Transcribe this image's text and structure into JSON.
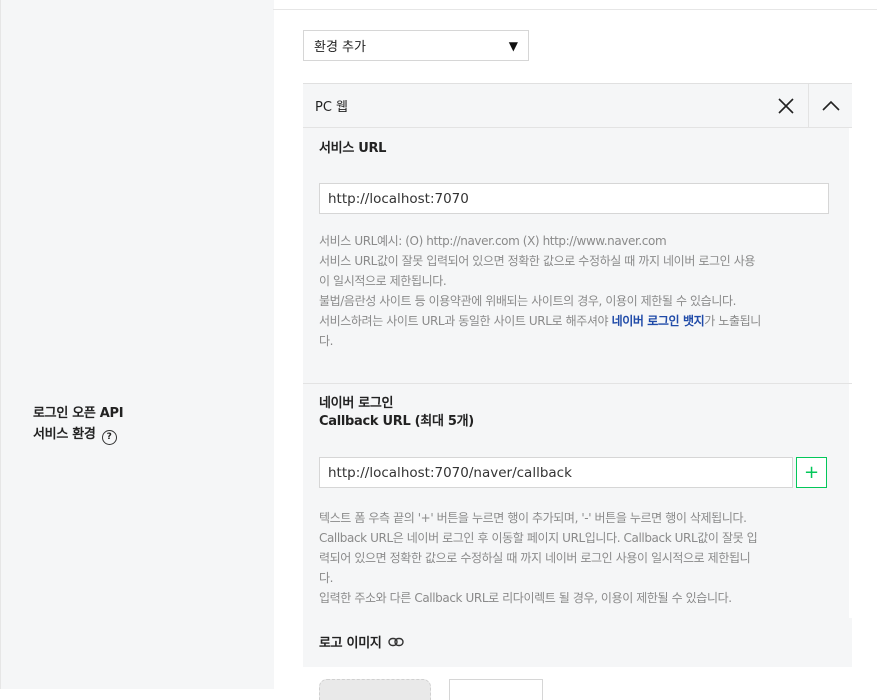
{
  "field": {
    "label_line1": "로그인 오픈 API",
    "label_line2": "서비스 환경",
    "help": "?"
  },
  "env_select": {
    "value": "환경 추가",
    "caret": "▼"
  },
  "panel": {
    "title": "PC 웹",
    "service_url": {
      "title": "서비스 URL",
      "value": "http://localhost:7070",
      "help": [
        "서비스 URL예시: (O) http://naver.com (X) http://www.naver.com",
        "서비스 URL값이 잘못 입력되어 있으면 정확한 값으로 수정하실 때 까지 네이버 로그인 사용",
        "이 일시적으로 제한됩니다.",
        "불법/음란성 사이트 등 이용약관에 위배되는 사이트의 경우, 이용이 제한될 수 있습니다."
      ],
      "help_last_prefix": "서비스하려는 사이트 URL과 동일한 사이트 URL로 해주셔야 ",
      "help_last_bold": "네이버 로그인 뱃지",
      "help_last_suffix": "가 노출됩니",
      "help_last_wrap": "다."
    },
    "callback": {
      "title_line1": "네이버 로그인",
      "title_line2": "Callback URL (최대 5개)",
      "value": "http://localhost:7070/naver/callback",
      "add_label": "+",
      "help": [
        "텍스트 폼 우측 끝의 '+' 버튼을 누르면 행이 추가되며, '-' 버튼을 누르면 행이 삭제됩니다.",
        "Callback URL은 네이버 로그인 후 이동할 페이지 URL입니다. Callback URL값이 잘못 입",
        "력되어 있으면 정확한 값으로 수정하실 때 까지 네이버 로그인 사용이 일시적으로 제한됩니",
        "다.",
        "입력한 주소와 다른 Callback URL로 리다이렉트 될 경우, 이용이 제한될 수 있습니다."
      ]
    },
    "logo": {
      "title": "로고 이미지"
    }
  },
  "colors": {
    "accent_green": "#03c75a",
    "badge_blue": "#1f4aa8"
  },
  "icons": [
    "help-icon",
    "close-icon",
    "chevron-up-icon",
    "link-icon",
    "plus-icon"
  ]
}
